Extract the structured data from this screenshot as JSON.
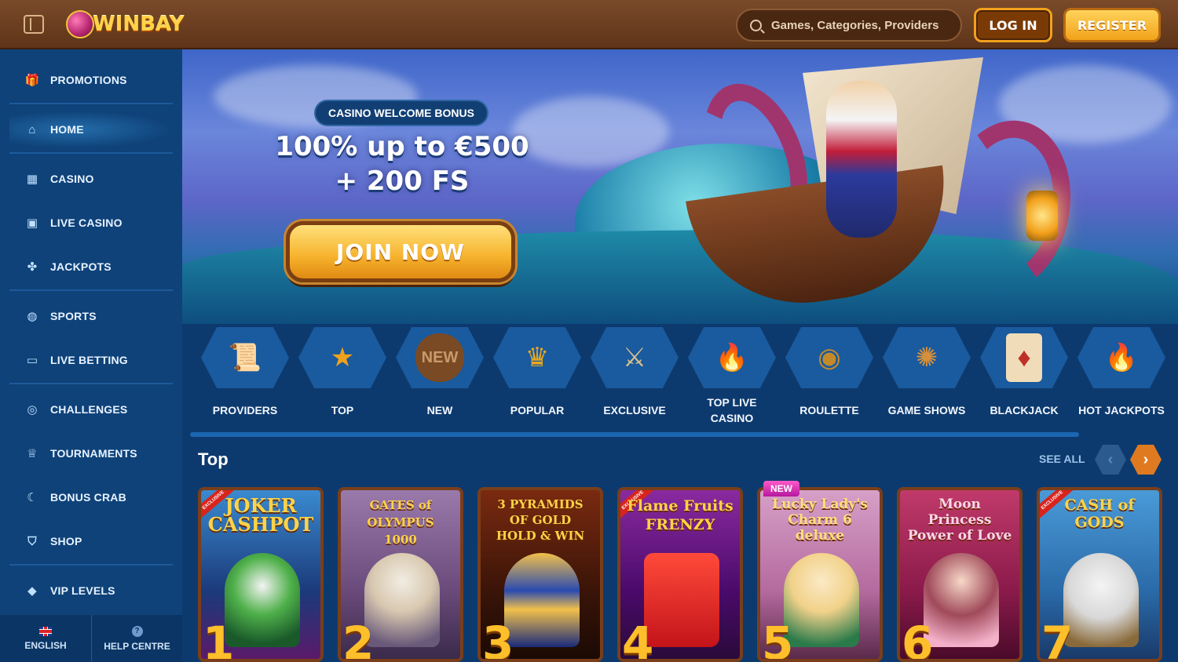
{
  "header": {
    "logo_text": "WINBAY",
    "search_placeholder": "Games, Categories, Providers",
    "login_label": "LOG IN",
    "register_label": "REGISTER"
  },
  "sidebar": {
    "items": [
      {
        "label": "PROMOTIONS",
        "icon": "gift-icon"
      },
      {
        "label": "HOME",
        "icon": "home-icon",
        "active": true
      },
      {
        "label": "CASINO",
        "icon": "slot-machine-icon"
      },
      {
        "label": "LIVE CASINO",
        "icon": "live-casino-icon"
      },
      {
        "label": "JACKPOTS",
        "icon": "clover-icon"
      },
      {
        "label": "SPORTS",
        "icon": "ball-icon"
      },
      {
        "label": "LIVE BETTING",
        "icon": "live-badge-icon"
      },
      {
        "label": "CHALLENGES",
        "icon": "target-icon"
      },
      {
        "label": "TOURNAMENTS",
        "icon": "trophy-icon"
      },
      {
        "label": "BONUS CRAB",
        "icon": "claw-icon"
      },
      {
        "label": "SHOP",
        "icon": "basket-icon"
      },
      {
        "label": "VIP LEVELS",
        "icon": "diamond-icon"
      }
    ],
    "footer": {
      "language_label": "ENGLISH",
      "help_label": "HELP CENTRE"
    }
  },
  "hero": {
    "pill_label": "CASINO WELCOME BONUS",
    "line1": "100% up to €500",
    "line2": "+ 200 FS",
    "cta_label": "JOIN NOW"
  },
  "categories": [
    {
      "label": "PROVIDERS",
      "icon": "scroll-icon",
      "color": "#e23a3a"
    },
    {
      "label": "TOP",
      "icon": "star-icon",
      "color": "#f0a21c"
    },
    {
      "label": "NEW",
      "icon": "barrel-icon",
      "color": "#9a6a3a"
    },
    {
      "label": "POPULAR",
      "icon": "cup-icon",
      "color": "#e6a820"
    },
    {
      "label": "EXCLUSIVE",
      "icon": "swords-icon",
      "color": "#c9a560"
    },
    {
      "label": "TOP LIVE\nCASINO",
      "icon": "torch-icon",
      "color": "#e6552a"
    },
    {
      "label": "ROULETTE",
      "icon": "roulette-icon",
      "color": "#c48a2a"
    },
    {
      "label": "GAME SHOWS",
      "icon": "wheel-icon",
      "color": "#d7903a"
    },
    {
      "label": "BLACKJACK",
      "icon": "cards-icon",
      "color": "#d9b68a"
    },
    {
      "label": "HOT JACKPOTS",
      "icon": "fire-icon",
      "color": "#e8401e"
    }
  ],
  "top_section": {
    "title": "Top",
    "see_all_label": "SEE ALL"
  },
  "games": [
    {
      "title": "JOKER\nCASHPOT",
      "rank": "1",
      "exclusive": true,
      "bg": "#2a5a9e",
      "accent": "#4fb04a"
    },
    {
      "title": "GATES of OLYMPUS\n1000",
      "rank": "2",
      "bg": "#8a6a9a",
      "accent": "#e2d7c8"
    },
    {
      "title": "3 PYRAMIDS\nOF GOLD\nHOLD & WIN",
      "rank": "3",
      "new": true,
      "bg": "#5a1a10",
      "accent": "#e0a82a"
    },
    {
      "title": "Flame Fruits\nFRENZY",
      "rank": "4",
      "exclusive": true,
      "bg": "#7a1a8a",
      "accent": "#d8241c"
    },
    {
      "title": "Lucky Lady's\nCharm 6\ndeluxe",
      "rank": "5",
      "bg": "#c46a9e",
      "accent": "#f6e0b8"
    },
    {
      "title": "Moon\nPrincess\nPower of Love",
      "rank": "6",
      "bg": "#a02a5a",
      "accent": "#f3b0c8"
    },
    {
      "title": "CASH of\nGODS",
      "rank": "7",
      "exclusive": true,
      "bg": "#3a82c8",
      "accent": "#e8e8e8"
    }
  ],
  "labels": {
    "new_tag": "NEW",
    "exclusive_tag": "EXCLUSIVE"
  }
}
